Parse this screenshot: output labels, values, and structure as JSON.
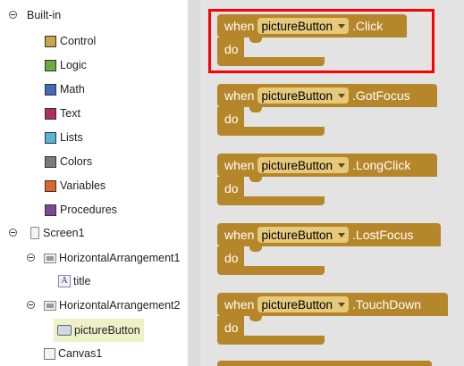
{
  "tree": {
    "builtin": {
      "label": "Built-in",
      "items": [
        {
          "label": "Control",
          "color": "#c9a54a",
          "icon": "control-swatch"
        },
        {
          "label": "Logic",
          "color": "#6dab3c",
          "icon": "logic-swatch"
        },
        {
          "label": "Math",
          "color": "#3f6db5",
          "icon": "math-swatch"
        },
        {
          "label": "Text",
          "color": "#b32d5e",
          "icon": "text-swatch"
        },
        {
          "label": "Lists",
          "color": "#5cb3d9",
          "icon": "lists-swatch"
        },
        {
          "label": "Colors",
          "color": "#7a7a7a",
          "icon": "colors-swatch"
        },
        {
          "label": "Variables",
          "color": "#e0642e",
          "icon": "variables-swatch"
        },
        {
          "label": "Procedures",
          "color": "#7b4a95",
          "icon": "procedures-swatch"
        }
      ]
    },
    "screen1": "Screen1",
    "harr1": "HorizontalArrangement1",
    "title": "title",
    "harr2": "HorizontalArrangement2",
    "picture_button": "pictureButton",
    "canvas1": "Canvas1"
  },
  "blocks": [
    {
      "when": "when",
      "component": "pictureButton",
      "event": ".Click",
      "do": "do"
    },
    {
      "when": "when",
      "component": "pictureButton",
      "event": ".GotFocus",
      "do": "do"
    },
    {
      "when": "when",
      "component": "pictureButton",
      "event": ".LongClick",
      "do": "do"
    },
    {
      "when": "when",
      "component": "pictureButton",
      "event": ".LostFocus",
      "do": "do"
    },
    {
      "when": "when",
      "component": "pictureButton",
      "event": ".TouchDown",
      "do": "do"
    }
  ],
  "colors": {
    "event_block": "#b5862a",
    "dropdown": "#e6c97a",
    "highlight": "#ff0000",
    "workspace": "#e3e3e3"
  }
}
